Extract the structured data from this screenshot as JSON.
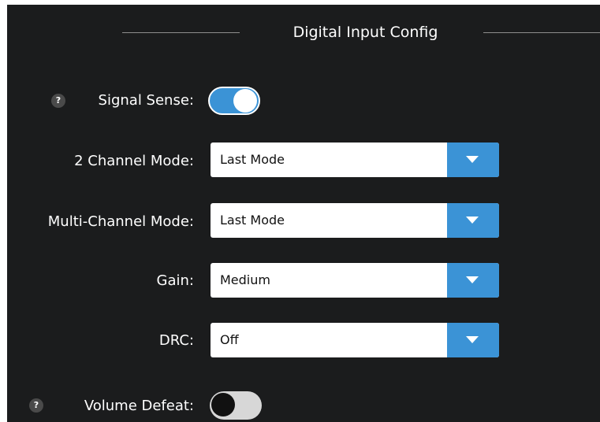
{
  "section": {
    "title": "Digital Input Config"
  },
  "help_icon_glyph": "?",
  "rows": {
    "signal_sense": {
      "label": "Signal Sense:",
      "state": "on"
    },
    "two_channel_mode": {
      "label": "2 Channel Mode:",
      "value": "Last Mode"
    },
    "multi_channel_mode": {
      "label": "Multi-Channel Mode:",
      "value": "Last Mode"
    },
    "gain": {
      "label": "Gain:",
      "value": "Medium"
    },
    "drc": {
      "label": "DRC:",
      "value": "Off"
    },
    "volume_defeat": {
      "label": "Volume Defeat:",
      "state": "off"
    }
  },
  "colors": {
    "panel_bg": "#1b1c1d",
    "accent": "#3b93d6",
    "toggle_off_track": "#d7d7d7",
    "text": "#ffffff"
  },
  "icons": {
    "help": "help-icon",
    "dropdown": "chevron-down-icon"
  }
}
